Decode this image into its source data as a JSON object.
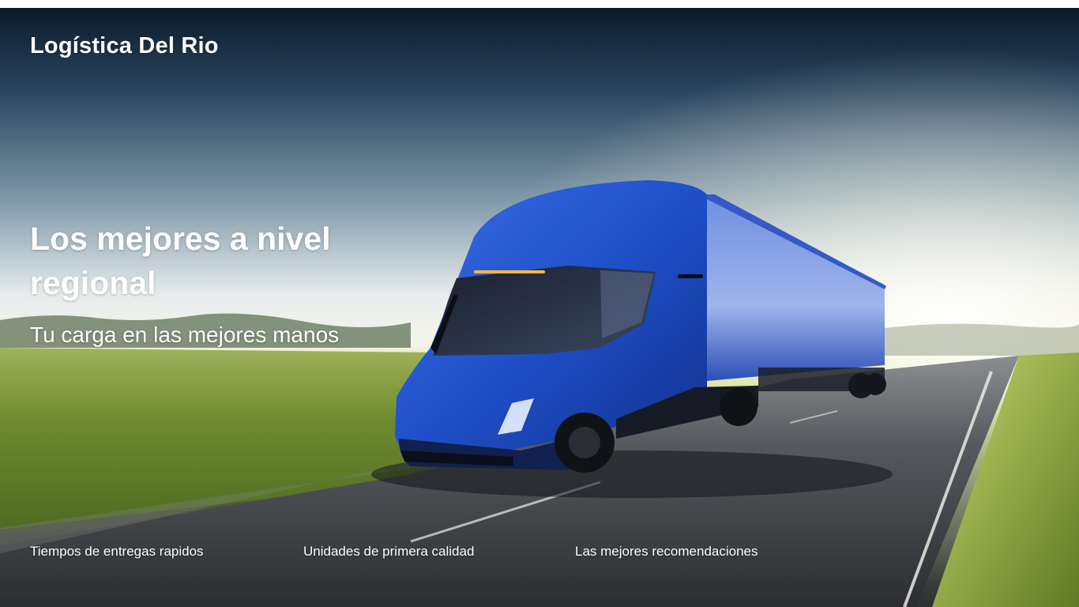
{
  "brand": {
    "name": "Logística Del Rio"
  },
  "hero": {
    "headline": "Los mejores a nivel regional",
    "subheadline": "Tu carga en las mejores manos",
    "image": "blue-electric-semi-truck-on-highway"
  },
  "features": [
    {
      "label": "Tiempos de entregas rapidos"
    },
    {
      "label": "Unidades de primera calidad"
    },
    {
      "label": "Las mejores recomendaciones"
    }
  ],
  "colors": {
    "text": "#ffffff",
    "truck": "#1e4fd0",
    "sky_top": "#0b1a2b",
    "grass": "#6e8a2c",
    "road": "#2f3136"
  }
}
